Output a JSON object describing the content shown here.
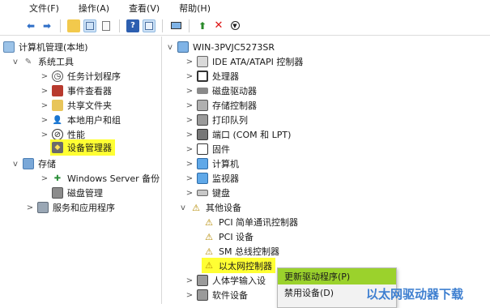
{
  "menu": [
    "文件(F)",
    "操作(A)",
    "查看(V)",
    "帮助(H)"
  ],
  "toolbar_icons": [
    "back-icon",
    "forward-icon",
    "folder-up-icon",
    "console-tree-icon",
    "export-list-icon",
    "help-icon",
    "properties-icon",
    "monitor-icon",
    "update-driver-icon",
    "uninstall-icon",
    "scan-icon"
  ],
  "left_tree": {
    "root": "计算机管理(本地)",
    "system_tools": "系统工具",
    "task_scheduler": "任务计划程序",
    "event_viewer": "事件查看器",
    "shared_folders": "共享文件夹",
    "local_users": "本地用户和组",
    "performance": "性能",
    "device_manager": "设备管理器",
    "storage": "存储",
    "windows_server_backup": "Windows Server 备份",
    "disk_management": "磁盘管理",
    "services_apps": "服务和应用程序"
  },
  "device_tree": {
    "computer_name": "WIN-3PVJC5273SR",
    "categories": [
      {
        "label": "IDE ATA/ATAPI 控制器",
        "icon": "ide-controller-icon"
      },
      {
        "label": "处理器",
        "icon": "processor-icon"
      },
      {
        "label": "磁盘驱动器",
        "icon": "disk-drive-icon"
      },
      {
        "label": "存储控制器",
        "icon": "storage-controller-icon"
      },
      {
        "label": "打印队列",
        "icon": "printer-icon"
      },
      {
        "label": "端口 (COM 和 LPT)",
        "icon": "port-icon"
      },
      {
        "label": "固件",
        "icon": "firmware-icon"
      },
      {
        "label": "计算机",
        "icon": "computer-icon"
      },
      {
        "label": "监视器",
        "icon": "monitor-icon"
      },
      {
        "label": "键盘",
        "icon": "keyboard-icon"
      }
    ],
    "other_devices": "其他设备",
    "other_children": [
      "PCI 简单通讯控制器",
      "PCI 设备",
      "SM 总线控制器",
      "以太网控制器"
    ],
    "after": [
      "人体学输入设",
      "软件设备"
    ]
  },
  "context_menu": {
    "update_driver": "更新驱动程序(P)",
    "disable_device": "禁用设备(D)"
  },
  "watermark": "以太网驱动器下载",
  "colors": {
    "highlight": "#ffff33",
    "menu_active": "#9bd22c",
    "watermark": "#3e7fd0"
  }
}
